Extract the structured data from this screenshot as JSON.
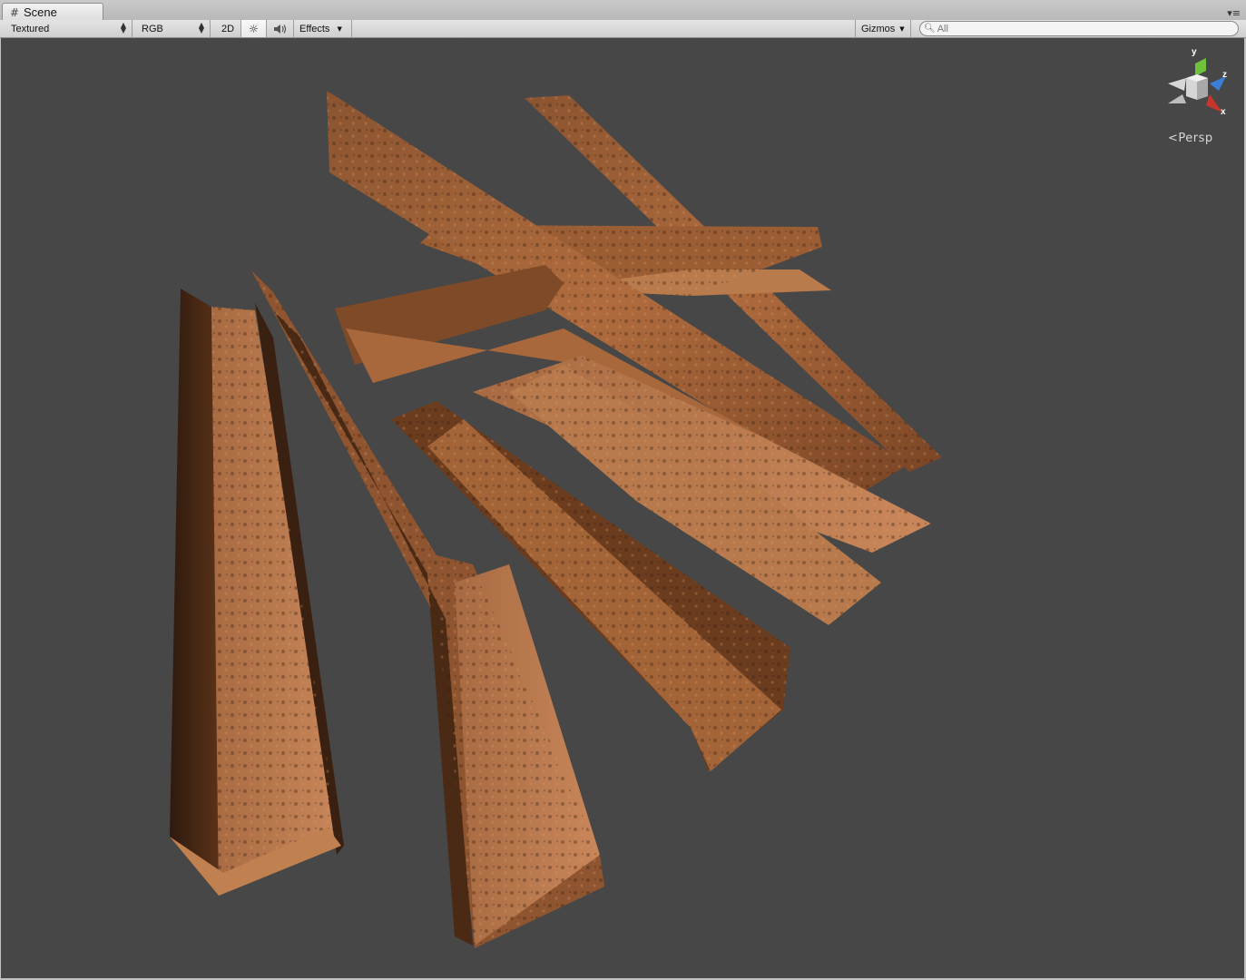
{
  "tab": {
    "title": "Scene"
  },
  "toolbar": {
    "draw_mode": "Textured",
    "render_mode": "RGB",
    "mode_2d": "2D",
    "effects_label": "Effects",
    "gizmos_label": "Gizmos",
    "search_placeholder": "All"
  },
  "gizmo": {
    "axis_y": "y",
    "axis_z": "z",
    "axis_x": "x"
  },
  "view": {
    "projection": "Persp"
  },
  "colors": {
    "viewport_bg": "#474747",
    "axis_y": "#6fc23c",
    "axis_z": "#3a7fd6",
    "axis_x": "#c8352a"
  },
  "icons": [
    "scene-hash-icon",
    "tab-menu-icon",
    "lighting-sun-icon",
    "audio-speaker-icon",
    "search-icon"
  ]
}
